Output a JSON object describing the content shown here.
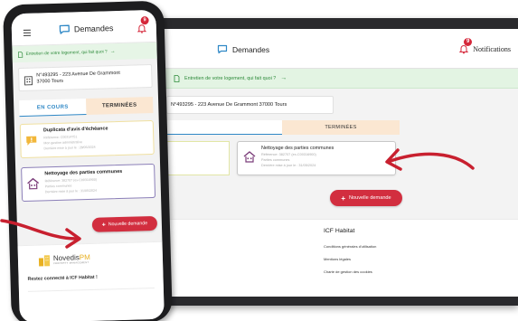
{
  "desktop": {
    "brand": "Demandes",
    "notifications_label": "Notifications",
    "notification_count": "9",
    "banner": "Entretien de votre logement, qui fait quoi ?",
    "banner_arrow": "→",
    "address": "N°493295 - 223 Avenue De Grammont 37000 Tours",
    "tabs": [
      {
        "label": ""
      },
      {
        "label": "TERMINÉES"
      }
    ],
    "card": {
      "title": "Nettoyage des parties communes",
      "lines": [
        "Référence: 382707 (ex-C00316900)",
        "Parties communes",
        "Dernière mise à jour le : 31/05/2024"
      ]
    },
    "new_button": "Nouvelle demande",
    "new_button_icon": "+",
    "footer": {
      "title": "ICF Habitat",
      "links": [
        "Conditions générales d'utilisation",
        "Mentions légales",
        "Charte de gestion des cookies"
      ]
    }
  },
  "mobile": {
    "brand": "Demandes",
    "notification_count": "9",
    "banner": "Entretien de votre logement, qui fait quoi ?",
    "banner_arrow": "→",
    "address_line1": "N°493295 - 223 Avenue De Grammont",
    "address_line2": "37000 Tours",
    "tabs": [
      {
        "label": "EN COURS"
      },
      {
        "label": "TERMINÉES"
      }
    ],
    "cards": [
      {
        "title": "Duplicata d'avis d'échéance",
        "lines": [
          "Référence: C00314751",
          "Mon gestion administrative",
          "Dernière mise à jour le : 28/05/2024"
        ]
      },
      {
        "title": "Nettoyage des parties communes",
        "lines": [
          "Référence: 382707 (ex-C00316900)",
          "Parties communes",
          "Dernière mise à jour le : 31/05/2024"
        ]
      }
    ],
    "new_button": "Nouvelle demande",
    "new_button_icon": "+",
    "logo_name_part1": "Novedis",
    "logo_name_part2": "PM",
    "logo_sub": "PROPERTY MANAGEMENT",
    "stay_connected": "Restez connecté à ICF Habitat !"
  },
  "colors": {
    "accent_blue": "#2f88c6",
    "button_red": "#d22e3f",
    "banner_green": "#2d8a3a",
    "tab_inactive": "#fbe7d2",
    "arrow_red": "#c8202f"
  }
}
